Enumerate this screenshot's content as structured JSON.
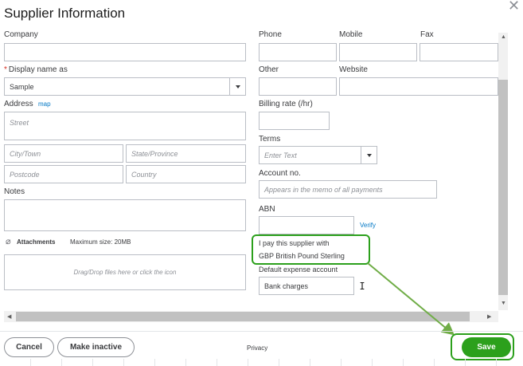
{
  "dialog": {
    "title": "Supplier Information"
  },
  "left": {
    "company_label": "Company",
    "display_name_label": "Display name as",
    "display_name_value": "Sample",
    "address_label": "Address",
    "map_link": "map",
    "street_placeholder": "Street",
    "city_placeholder": "City/Town",
    "state_placeholder": "State/Province",
    "postcode_placeholder": "Postcode",
    "country_placeholder": "Country",
    "notes_label": "Notes",
    "attachments_label": "Attachments",
    "max_size": "Maximum size: 20MB",
    "dropzone_text": "Drag/Drop files here or click the icon"
  },
  "right": {
    "phone_label": "Phone",
    "mobile_label": "Mobile",
    "fax_label": "Fax",
    "other_label": "Other",
    "website_label": "Website",
    "billing_rate_label": "Billing rate (/hr)",
    "terms_label": "Terms",
    "terms_placeholder": "Enter Text",
    "account_no_label": "Account no.",
    "account_no_placeholder": "Appears in the memo of all payments",
    "abn_label": "ABN",
    "verify_link": "Verify",
    "currency_label": "I pay this supplier with",
    "currency_value": "GBP British Pound Sterling",
    "expense_label": "Default expense account",
    "expense_value": "Bank charges"
  },
  "footer": {
    "cancel": "Cancel",
    "make_inactive": "Make inactive",
    "privacy": "Privacy",
    "save": "Save"
  },
  "colors": {
    "accent": "#2ca01c",
    "link": "#0077c5"
  }
}
